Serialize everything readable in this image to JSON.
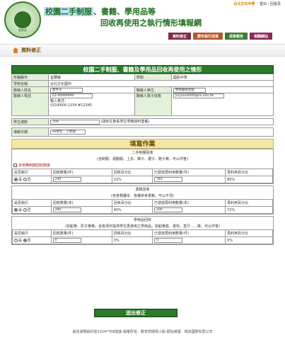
{
  "header": {
    "seal_text": "MINISTRY OF EDUCATION",
    "seal_sub": "教育部",
    "title_line1_pre": "校園二手制服",
    "title_line1_post": "、書籍、學用品等",
    "title_line2": "回收再使用之執行情形填報網",
    "school_link": "台北文化中學",
    "link_logout": "登出",
    "link_home": "回首頁",
    "nav": [
      "資料修正",
      "歷年執行成果",
      "成果報告",
      "相關網站"
    ]
  },
  "crumb": "資料修正",
  "form": {
    "header": "校園二手制服、書籍及學用品回收再使用之情形",
    "rows": [
      {
        "l1": "所屬縣市",
        "v1": "宜蘭縣",
        "l2": "學制",
        "v2": "國民中學"
      },
      {
        "l1": "學校名稱",
        "v1": "台北文化國中"
      }
    ],
    "contact_name_label": "聯絡人姓名",
    "contact_name": "蔡宇天",
    "contact_unit_label": "聯絡人單位",
    "contact_unit": "學務處衛生組",
    "contact_phone_label": "聯絡人電話",
    "contact_phone": "02-99999999",
    "phone_hint_title": "輸入格式：",
    "phone_hint": "(02)6600-1234 #12345",
    "contact_email_label": "聯絡人電子信箱",
    "contact_email": "yuyanu0000@sa.edu.tw",
    "students_label": "學生總數",
    "students": "709",
    "students_note": "(請依生態系學生學籍資料登載)",
    "period_label": "填報日期",
    "period": "99學年 - 下學期"
  },
  "section": "填寫作業",
  "uniform": {
    "title": "二手制服回收",
    "sub": "(含制服、運動服、上衣、褲子、裙子、鞋子等，可以作答)",
    "check_label": "本校無制服回收制度",
    "headers": [
      "是否執行",
      "回收數量(件)",
      "回收百分比",
      "已發放再利用數量(件)",
      "再利用百分比"
    ],
    "yes": "是",
    "no": "否",
    "qty": "240",
    "pct": "22%",
    "reuse": "783",
    "reuse_pct": "80%"
  },
  "books": {
    "title": "書籍回收",
    "sub": "(含各類課本、各種參考書籍，可以不須)",
    "headers": [
      "是否執行",
      "回收數量(本)",
      "回收百分比",
      "已發放再利用數量(本)",
      "再利用百分比"
    ],
    "yes": "是",
    "no": "否",
    "qty": "280",
    "pct": "40%",
    "reuse": "200",
    "reuse_pct": "72%"
  },
  "supplies": {
    "title": "學用品回收",
    "sub": "(如鉛筆、原子筆等，含各項可提供學生再使用之學用品，如鉛筆盒、書包、直尺……等，可以作答)",
    "headers": [
      "是否執行",
      "回收數量(件)",
      "回收百分比",
      "已發放再利用數量(件)",
      "再利用百分比"
    ],
    "yes": "是",
    "no": "否",
    "qty": "0",
    "pct": "0%",
    "reuse": "0",
    "reuse_pct": "0%"
  },
  "submit": "送出修正",
  "footer": "最佳瀏覽解析度1024*768建議  版權所有：教育部環保小組  網站維護：環資國際有限公司"
}
